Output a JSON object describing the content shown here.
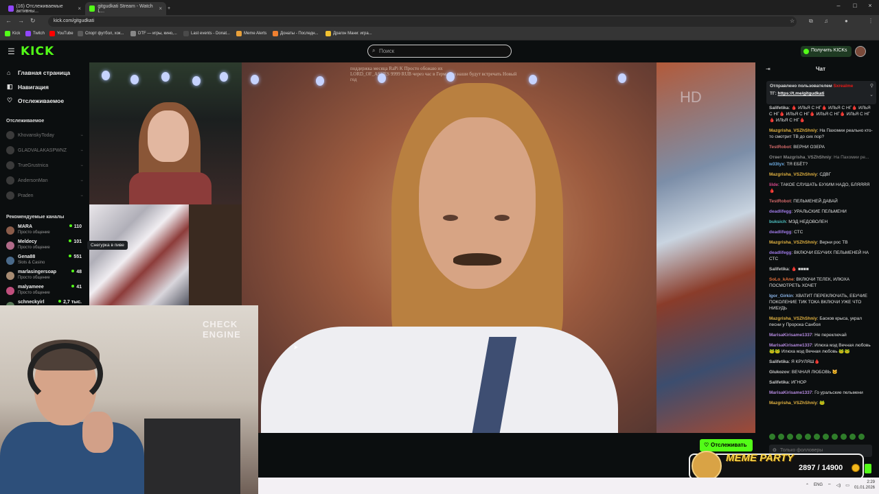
{
  "browser": {
    "tabs": [
      {
        "title": "(16) Отслеживаемые активны...",
        "active": false
      },
      {
        "title": "gitgudkati Stream - Watch L...",
        "active": true
      }
    ],
    "url": "kick.com/gitgudkati",
    "bookmarks": [
      "Kick",
      "Twitch",
      "YouTube",
      "Спорт футбол, хок...",
      "DTF — игры, кино,...",
      "Last events - Donat...",
      "Meme Alerts",
      "Донаты - Последн...",
      "Драгон Мани: игра..."
    ]
  },
  "header": {
    "logo": "KICK",
    "search_placeholder": "Поиск",
    "get_kicks": "Получить KICKs"
  },
  "sidebar": {
    "nav": [
      "Главная страница",
      "Навигация",
      "Отслеживаемое"
    ],
    "following_title": "Отслеживаемое",
    "following": [
      "KhovanskyToday",
      "GLADVALAKASPWNZ",
      "TrueGrustnica",
      "AndersonMan",
      "Praden"
    ],
    "recommended_title": "Рекомендуемые каналы",
    "recommended": [
      {
        "name": "MARA",
        "category": "Просто общение",
        "viewers": "110",
        "color": "#8a5c4a"
      },
      {
        "name": "Meldecy",
        "category": "Просто общение",
        "viewers": "101",
        "color": "#b06a88"
      },
      {
        "name": "Gena88",
        "category": "Slots & Casino",
        "viewers": "551",
        "color": "#4a6a8a"
      },
      {
        "name": "marlasingersoap",
        "category": "Просто общение",
        "viewers": "48",
        "color": "#a68b72"
      },
      {
        "name": "malyameee",
        "category": "Просто общение",
        "viewers": "41",
        "color": "#c04f7d"
      },
      {
        "name": "schneckyirl",
        "category": "",
        "viewers": "2,7 тыс.",
        "color": "#5a7a5a"
      }
    ],
    "tooltip": "Снегурка в пиве"
  },
  "stream": {
    "overlay_line1": "поддержка месяца  RaPi K  Просто обожаю их",
    "overlay_line2": "LORD_OF_ASHES  9999 RUB  через час в Германии наши будут встречать Новый",
    "overlay_line3": "год",
    "watermark": "HD"
  },
  "webcam": {
    "neon_text": "CHECK ENGINE"
  },
  "follow_button": "Отслеживать",
  "chat": {
    "title": "Чат",
    "pinned_by_label": "Отправлено пользователем",
    "pinned_by": "Sxrealme",
    "pinned_text_prefix": "ТГ:",
    "pinned_link": "https://t.me/gitgudkati",
    "messages": [
      {
        "user": "Salifetika",
        "color": "#c9c9c9",
        "text": "🩸 ИЛЬЯ С НГ🩸 ИЛЬЯ С НГ🩸 ИЛЬЯ С НГ🩸 ИЛЬЯ С НГ🩸 ИЛЬЯ С НГ🩸 ИЛЬЯ С НГ🩸 ИЛЬЯ С НГ🩸"
      },
      {
        "user": "Mazgrisha_VSZhShniy",
        "color": "#e3b341",
        "text": "На Пахомии реально кто-то смотрит ТВ до сих пор?"
      },
      {
        "user": "TestRobot",
        "color": "#d46a6a",
        "text": "ВЕРНИ ОЗЕРА"
      },
      {
        "user": "Ответ Mazgrisha_VSZhShniy",
        "color": "#8a8a8a",
        "text": "На Пахомии ре...",
        "reply": true
      },
      {
        "user": "w33tyx",
        "color": "#6fb0e8",
        "text": "ТЯ ЕБЁТ?"
      },
      {
        "user": "Mazgrisha_VSZhShniy",
        "color": "#e3b341",
        "text": "СДВГ"
      },
      {
        "user": "lilde",
        "color": "#d4478a",
        "text": "ТАКОЕ СЛУШАТЬ БУХИМ НАДО, БЛЯЯЯЯ🩸"
      },
      {
        "user": "TestRobot",
        "color": "#d46a6a",
        "text": "ПЕЛЬМЕНЕЙ ДАВАЙ"
      },
      {
        "user": "deadlifegg",
        "color": "#9f7ae8",
        "text": "УРАЛЬСКИЕ ПЕЛЬМЕНИ"
      },
      {
        "user": "buksich",
        "color": "#4fc3c3",
        "text": "МЭД НЕДОВОЛЕН"
      },
      {
        "user": "deadlifegg",
        "color": "#9f7ae8",
        "text": "СТС"
      },
      {
        "user": "Mazgrisha_VSZhShniy",
        "color": "#e3b341",
        "text": "Верни рос ТВ"
      },
      {
        "user": "deadlifegg",
        "color": "#9f7ae8",
        "text": "ВКЛЮЧИ ЕБУЧИХ ПЕЛЬМЕНЕЙ НА СТС"
      },
      {
        "user": "Salifetika",
        "color": "#c9c9c9",
        "text": "🩸 ■■■■"
      },
      {
        "user": "SoLo_kAne",
        "color": "#e36f3c",
        "text": "ВКЛЮЧИ ТЕЛЕК, ИЛЮХА ПОСМОТРЕТЬ ХОЧЕТ"
      },
      {
        "user": "Igor_Girkin",
        "color": "#8ab4e8",
        "text": "ХВАТИТ ПЕРЕКЛЮЧАТЬ, ЕБУЧИЕ ПОКОЛЕНИЕ ТИК ТОКА ВКЛЮЧИ УЖЕ ЧТО НИБУДЬ"
      },
      {
        "user": "Mazgrisha_VSZhShniy",
        "color": "#e3b341",
        "text": "Басков крыса, украл песни у Пророка Санбоя"
      },
      {
        "user": "MarisaKirisame1337",
        "color": "#b58ae0",
        "text": "Не переключай"
      },
      {
        "user": "MarisaKirisame1337",
        "color": "#b58ae0",
        "text": "Илюха мэд Вечная любовь 🐸🐸 Илюха мэд Вечная любовь 🐸🐸"
      },
      {
        "user": "Salifetika",
        "color": "#c9c9c9",
        "text": "Я КРУЛЯШ🩸"
      },
      {
        "user": "Glukozov",
        "color": "#c9c9c9",
        "text": "ВЕЧНАЯ ЛЮБОВЬ 🐱"
      },
      {
        "user": "Salifetika",
        "color": "#c9c9c9",
        "text": "ИГНОР"
      },
      {
        "user": "MarisaKirisame1337",
        "color": "#b58ae0",
        "text": "Го уральские пельмени"
      },
      {
        "user": "Mazgrisha_VSZhShniy",
        "color": "#e3b341",
        "text": "🐸"
      }
    ],
    "input_placeholder": "Только фолловеры"
  },
  "meme_party": {
    "label": "MEME PARTY",
    "progress": "2897 / 14900"
  },
  "taskbar": {
    "lang": "ENG",
    "time": "2:29",
    "date": "01.01.2026"
  },
  "colors": {
    "accent": "#53fc18"
  }
}
